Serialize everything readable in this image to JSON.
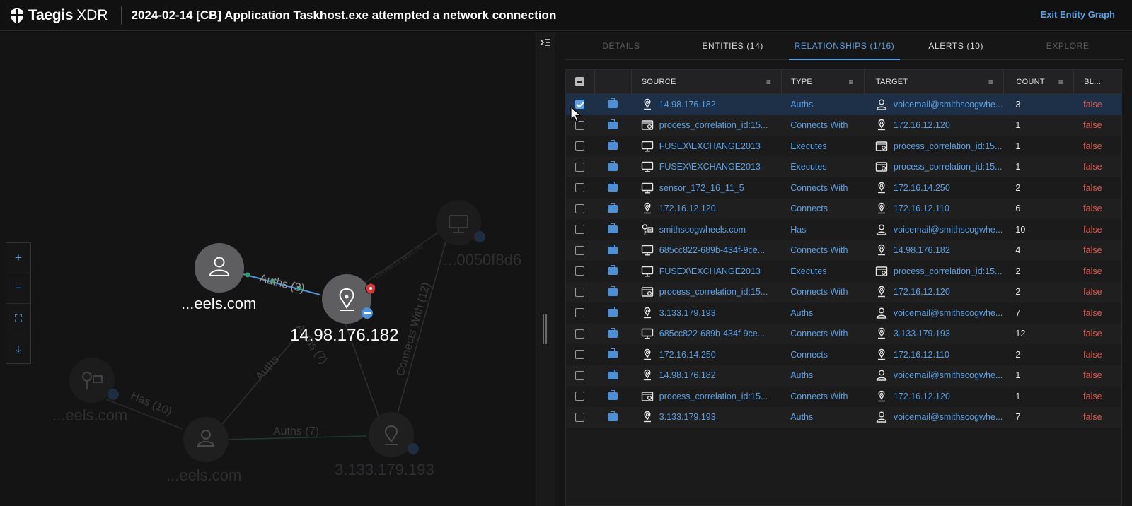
{
  "header": {
    "brand": "Taegis",
    "brand_suffix": "XDR",
    "title": "2024-02-14 [CB] Application Taskhost.exe attempted a network connection",
    "exit_label": "Exit Entity Graph"
  },
  "graph": {
    "nodes": {
      "user_main": "...eels.com",
      "ip_main": "14.98.176.182",
      "host_faded": "...0050f8d6",
      "key_faded": "...eels.com",
      "user_faded": "...eels.com",
      "ip_faded": "3.133.179.193"
    },
    "edges": {
      "auths_main": "Auths (3)",
      "connects_with_4": "Connects With (4)",
      "connects_with_12": "Connects With (12)",
      "auths_7_diag": "Auths (7)",
      "auths_plain": "Auths",
      "has_10": "Has (10)",
      "auths_7_bottom": "Auths (7)"
    },
    "controls": {
      "zoom_in": "+",
      "zoom_out": "−",
      "fit": "⛶",
      "download": "⤓"
    }
  },
  "tabs": [
    {
      "label": "DETAILS",
      "state": "disabled"
    },
    {
      "label": "ENTITIES  (14)",
      "state": "normal"
    },
    {
      "label": "RELATIONSHIPS  (1/16)",
      "state": "active"
    },
    {
      "label": "ALERTS  (10)",
      "state": "normal"
    },
    {
      "label": "EXPLORE",
      "state": "disabled"
    }
  ],
  "table": {
    "columns": {
      "source": "SOURCE",
      "type": "TYPE",
      "target": "TARGET",
      "count": "COUNT",
      "bl": "BL..."
    },
    "rows": [
      {
        "src_icon": "location-icon",
        "source": "14.98.176.182",
        "type": "Auths",
        "tgt_icon": "user-icon",
        "target": "voicemail@smithscogwhe...",
        "count": "3",
        "bl": "false",
        "selected": true
      },
      {
        "src_icon": "process-icon",
        "source": "process_correlation_id:15...",
        "type": "Connects With",
        "tgt_icon": "location-icon",
        "target": "172.16.12.120",
        "count": "1",
        "bl": "false"
      },
      {
        "src_icon": "monitor-icon",
        "source": "FUSEX\\EXCHANGE2013",
        "type": "Executes",
        "tgt_icon": "process-icon",
        "target": "process_correlation_id:15...",
        "count": "1",
        "bl": "false"
      },
      {
        "src_icon": "monitor-icon",
        "source": "FUSEX\\EXCHANGE2013",
        "type": "Executes",
        "tgt_icon": "process-icon",
        "target": "process_correlation_id:15...",
        "count": "1",
        "bl": "false"
      },
      {
        "src_icon": "monitor-icon",
        "source": "sensor_172_16_11_5",
        "type": "Connects With",
        "tgt_icon": "location-icon",
        "target": "172.16.14.250",
        "count": "2",
        "bl": "false"
      },
      {
        "src_icon": "location-icon",
        "source": "172.16.12.120",
        "type": "Connects",
        "tgt_icon": "location-icon",
        "target": "172.16.12.110",
        "count": "6",
        "bl": "false"
      },
      {
        "src_icon": "key-icon",
        "source": "smithscogwheels.com",
        "type": "Has",
        "tgt_icon": "user-icon",
        "target": "voicemail@smithscogwhe...",
        "count": "10",
        "bl": "false"
      },
      {
        "src_icon": "monitor-icon",
        "source": "685cc822-689b-434f-9ce...",
        "type": "Connects With",
        "tgt_icon": "location-icon",
        "target": "14.98.176.182",
        "count": "4",
        "bl": "false"
      },
      {
        "src_icon": "monitor-icon",
        "source": "FUSEX\\EXCHANGE2013",
        "type": "Executes",
        "tgt_icon": "process-icon",
        "target": "process_correlation_id:15...",
        "count": "2",
        "bl": "false"
      },
      {
        "src_icon": "process-icon",
        "source": "process_correlation_id:15...",
        "type": "Connects With",
        "tgt_icon": "location-icon",
        "target": "172.16.12.120",
        "count": "2",
        "bl": "false"
      },
      {
        "src_icon": "location-icon",
        "source": "3.133.179.193",
        "type": "Auths",
        "tgt_icon": "user-icon",
        "target": "voicemail@smithscogwhe...",
        "count": "7",
        "bl": "false"
      },
      {
        "src_icon": "monitor-icon",
        "source": "685cc822-689b-434f-9ce...",
        "type": "Connects With",
        "tgt_icon": "location-icon",
        "target": "3.133.179.193",
        "count": "12",
        "bl": "false"
      },
      {
        "src_icon": "location-icon",
        "source": "172.16.14.250",
        "type": "Connects",
        "tgt_icon": "location-icon",
        "target": "172.16.12.110",
        "count": "2",
        "bl": "false"
      },
      {
        "src_icon": "location-icon",
        "source": "14.98.176.182",
        "type": "Auths",
        "tgt_icon": "user-icon",
        "target": "voicemail@smithscogwhe...",
        "count": "1",
        "bl": "false"
      },
      {
        "src_icon": "process-icon",
        "source": "process_correlation_id:15...",
        "type": "Connects With",
        "tgt_icon": "location-icon",
        "target": "172.16.12.120",
        "count": "1",
        "bl": "false"
      },
      {
        "src_icon": "location-icon",
        "source": "3.133.179.193",
        "type": "Auths",
        "tgt_icon": "user-icon",
        "target": "voicemail@smithscogwhe...",
        "count": "7",
        "bl": "false"
      }
    ]
  },
  "colors": {
    "accent": "#5aa0e6",
    "danger": "#e0584f",
    "edge_highlight": "#4f8fd6",
    "edge_green": "#2f9a6a"
  }
}
